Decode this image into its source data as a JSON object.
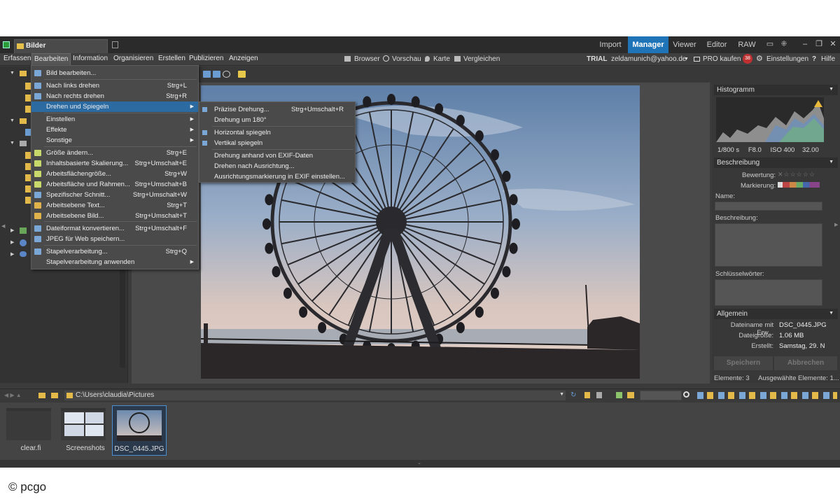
{
  "titlebar": {
    "tab_label": "Bilder",
    "modes": [
      "Import",
      "Manager",
      "Viewer",
      "Editor",
      "RAW"
    ],
    "active_mode": "Manager"
  },
  "menubar": {
    "items": [
      "Erfassen",
      "Bearbeiten",
      "Information",
      "Organisieren",
      "Erstellen",
      "Publizieren",
      "Anzeigen"
    ],
    "views": [
      "Browser",
      "Vorschau",
      "Karte",
      "Vergleichen"
    ],
    "trial": "TRIAL",
    "account": "zeldamunich@yahoo.de",
    "buy": "PRO kaufen",
    "badge": "38",
    "settings": "Einstellungen",
    "help": "Hilfe"
  },
  "bearbeiten_menu": [
    {
      "label": "Bild bearbeiten...",
      "shortcut": "",
      "icon_color": "#7aa7d6"
    },
    {
      "label": "Nach links drehen",
      "shortcut": "Strg+L",
      "icon_color": "#7aa7d6"
    },
    {
      "label": "Nach rechts drehen",
      "shortcut": "Strg+R",
      "icon_color": "#7aa7d6"
    },
    {
      "label": "Drehen und Spiegeln",
      "shortcut": "",
      "submenu": true
    },
    {
      "label": "Einstellen",
      "shortcut": "",
      "submenu": true
    },
    {
      "label": "Effekte",
      "shortcut": "",
      "submenu": true
    },
    {
      "label": "Sonstige",
      "shortcut": "",
      "submenu": true
    },
    {
      "label": "Größe ändern...",
      "shortcut": "Strg+E",
      "icon_color": "#c9d86a"
    },
    {
      "label": "Inhaltsbasierte Skalierung...",
      "shortcut": "Strg+Umschalt+E",
      "icon_color": "#c9d86a"
    },
    {
      "label": "Arbeitsflächengröße...",
      "shortcut": "Strg+W",
      "icon_color": "#c9d86a"
    },
    {
      "label": "Arbeitsfläche und Rahmen...",
      "shortcut": "Strg+Umschalt+B",
      "icon_color": "#c9d86a"
    },
    {
      "label": "Spezifischer Schnitt...",
      "shortcut": "Strg+Umschalt+W",
      "icon_color": "#7aa7d6"
    },
    {
      "label": "Arbeitsebene Text...",
      "shortcut": "Strg+T",
      "icon_color": "#e0b24c"
    },
    {
      "label": "Arbeitsebene Bild...",
      "shortcut": "Strg+Umschalt+T",
      "icon_color": "#e0b24c"
    },
    {
      "label": "Dateiformat konvertieren...",
      "shortcut": "Strg+Umschalt+F",
      "icon_color": "#7aa7d6"
    },
    {
      "label": "JPEG für Web speichern...",
      "shortcut": "",
      "icon_color": "#7aa7d6"
    },
    {
      "label": "Stapelverarbeitung...",
      "shortcut": "Strg+Q",
      "icon_color": "#7aa7d6"
    },
    {
      "label": "Stapelverarbeitung anwenden",
      "shortcut": "",
      "submenu": true
    }
  ],
  "drehen_submenu": [
    {
      "label": "Präzise Drehung...",
      "shortcut": "Strg+Umschalt+R"
    },
    {
      "label": "Drehung um 180°",
      "shortcut": ""
    },
    {
      "label": "Horizontal spiegeln",
      "shortcut": ""
    },
    {
      "label": "Vertikal spiegeln",
      "shortcut": ""
    },
    {
      "label": "Drehung anhand von EXIF-Daten",
      "shortcut": ""
    },
    {
      "label": "Drehen nach Ausrichtung...",
      "shortcut": ""
    },
    {
      "label": "Ausrichtungsmarkierung in EXIF einstellen...",
      "shortcut": ""
    }
  ],
  "right_panel": {
    "histogram_title": "Histogramm",
    "exif": {
      "shutter": "1/800 s",
      "aperture": "F8.0",
      "iso": "ISO 400",
      "focal": "32.00"
    },
    "beschreibung_title": "Beschreibung",
    "bewertung": "Bewertung:",
    "markierung": "Markierung:",
    "name": "Name:",
    "beschreibung": "Beschreibung:",
    "schluesselwoerter": "Schlüsselwörter:",
    "allgemein_title": "Allgemein",
    "file_rows": [
      {
        "key": "Dateiname mit Erw...",
        "value": "DSC_0445.JPG"
      },
      {
        "key": "Dateigröße:",
        "value": "1.06 MB"
      },
      {
        "key": "Erstellt:",
        "value": "Samstag, 29. N"
      }
    ],
    "save_btn": "Speichern",
    "cancel_btn": "Abbrechen",
    "elements": "Elemente: 3",
    "selected": "Ausgewählte Elemente: 1..."
  },
  "pathbar": {
    "path": "C:\\Users\\claudia\\Pictures"
  },
  "filmstrip": [
    {
      "label": "clear.fi",
      "type": "folder"
    },
    {
      "label": "Screenshots",
      "type": "folder"
    },
    {
      "label": "DSC_0445.JPG",
      "type": "photo",
      "selected": true
    }
  ],
  "watermark": "© pcgo"
}
